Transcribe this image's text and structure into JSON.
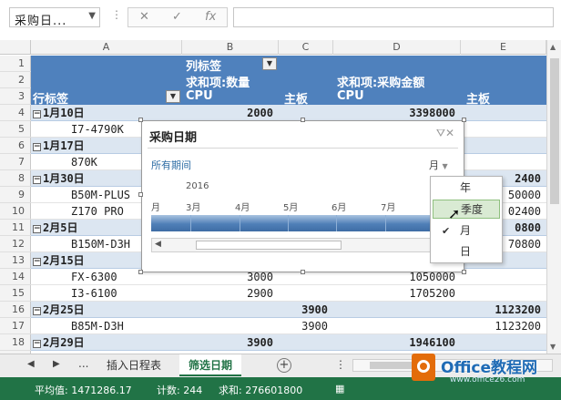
{
  "formula_bar": {
    "name_box": "采购日...",
    "cancel_icon": "✕",
    "enter_icon": "✓",
    "fx_label": "fx"
  },
  "columns": [
    "A",
    "B",
    "C",
    "D",
    "E"
  ],
  "rows": [
    "1",
    "2",
    "3",
    "4",
    "5",
    "6",
    "7",
    "8",
    "9",
    "10",
    "11",
    "12",
    "13",
    "14",
    "15",
    "16",
    "17",
    "18"
  ],
  "pivot": {
    "col_label": "列标签",
    "sum_qty": "求和项:数量",
    "sum_amount": "求和项:采购金额",
    "row_label": "行标签",
    "cpu": "CPU",
    "board": "主板",
    "data_rows": [
      {
        "label": "1月10日",
        "group": true,
        "b": "2000",
        "c": "",
        "d": "3398000",
        "e": ""
      },
      {
        "label": "I7-4790K",
        "group": false,
        "b": "",
        "c": "",
        "d": "",
        "e": ""
      },
      {
        "label": "1月17日",
        "group": true,
        "b": "",
        "c": "",
        "d": "",
        "e": ""
      },
      {
        "label": "870K",
        "group": false,
        "b": "",
        "c": "",
        "d": "",
        "e": ""
      },
      {
        "label": "1月30日",
        "group": true,
        "b": "",
        "c": "",
        "d": "",
        "e": "2400"
      },
      {
        "label": "B50M-PLUS",
        "group": false,
        "b": "",
        "c": "",
        "d": "",
        "e": "50000"
      },
      {
        "label": "Z170 PRO",
        "group": false,
        "b": "",
        "c": "",
        "d": "",
        "e": "02400"
      },
      {
        "label": "2月5日",
        "group": true,
        "b": "",
        "c": "",
        "d": "",
        "e": "0800"
      },
      {
        "label": "B150M-D3H",
        "group": false,
        "b": "",
        "c": "",
        "d": "",
        "e": "70800"
      },
      {
        "label": "2月15日",
        "group": true,
        "b": "",
        "c": "",
        "d": "",
        "e": ""
      },
      {
        "label": "FX-6300",
        "group": false,
        "b": "3000",
        "c": "",
        "d": "1050000",
        "e": ""
      },
      {
        "label": "I3-6100",
        "group": false,
        "b": "2900",
        "c": "",
        "d": "1705200",
        "e": ""
      },
      {
        "label": "2月25日",
        "group": true,
        "b": "",
        "c": "3900",
        "d": "",
        "e": "1123200"
      },
      {
        "label": "B85M-D3H",
        "group": false,
        "b": "",
        "c": "3900",
        "d": "",
        "e": "1123200"
      },
      {
        "label": "2月29日",
        "group": true,
        "b": "3900",
        "c": "",
        "d": "1946100",
        "e": ""
      }
    ]
  },
  "timeline": {
    "title": "采购日期",
    "period": "所有期间",
    "level": "月",
    "year": "2016",
    "months": [
      "月",
      "3月",
      "4月",
      "5月",
      "6月",
      "7月"
    ]
  },
  "level_menu": {
    "items": [
      "年",
      "季度",
      "月",
      "日"
    ],
    "highlighted": "季度",
    "checked": "月"
  },
  "sheet_tabs": {
    "more": "...",
    "tabs": [
      "插入日程表",
      "筛选日期"
    ],
    "active": "筛选日期",
    "add": "+"
  },
  "status_bar": {
    "average": "平均值: 1471286.17",
    "count": "计数: 244",
    "sum": "求和: 276601800"
  },
  "watermark": {
    "brand": "Office教程网",
    "url": "www.office26.com"
  },
  "colors": {
    "header_blue": "#4f81bd",
    "band": "#dce6f1",
    "excel_green": "#217346",
    "highlight": "#d9ead3"
  }
}
